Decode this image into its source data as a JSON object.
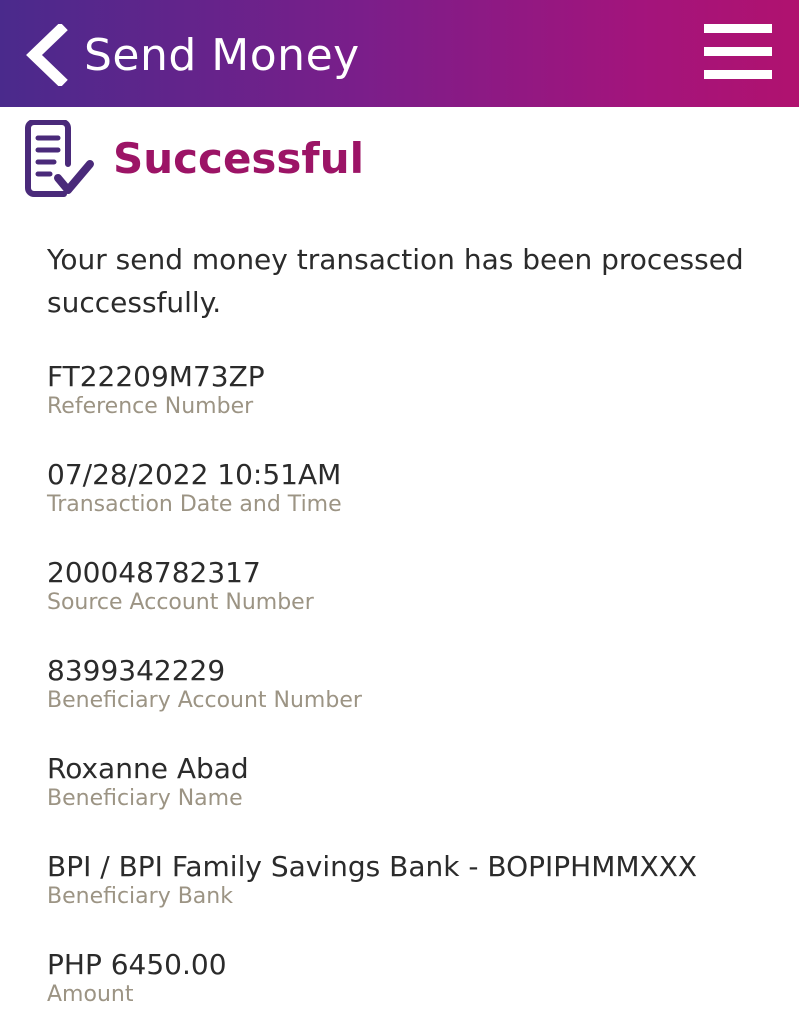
{
  "header": {
    "title": "Send Money",
    "back_icon": "chevron-left-icon",
    "menu_icon": "hamburger-menu-icon",
    "gradient_start": "#4a2a8c",
    "gradient_end": "#b0126f"
  },
  "status": {
    "icon": "document-check-icon",
    "text": "Successful",
    "color": "#9c1466"
  },
  "message": "Your send money transaction has been processed successfully.",
  "details": [
    {
      "value": "FT22209M73ZP",
      "label": "Reference Number"
    },
    {
      "value": "07/28/2022 10:51AM",
      "label": "Transaction Date and Time"
    },
    {
      "value": "200048782317",
      "label": "Source Account Number"
    },
    {
      "value": "8399342229",
      "label": "Beneficiary Account Number"
    },
    {
      "value": "Roxanne Abad",
      "label": "Beneficiary Name"
    },
    {
      "value": "BPI / BPI Family Savings Bank - BOPIPHMMXXX",
      "label": "Beneficiary Bank"
    },
    {
      "value": "PHP 6450.00",
      "label": "Amount"
    }
  ]
}
